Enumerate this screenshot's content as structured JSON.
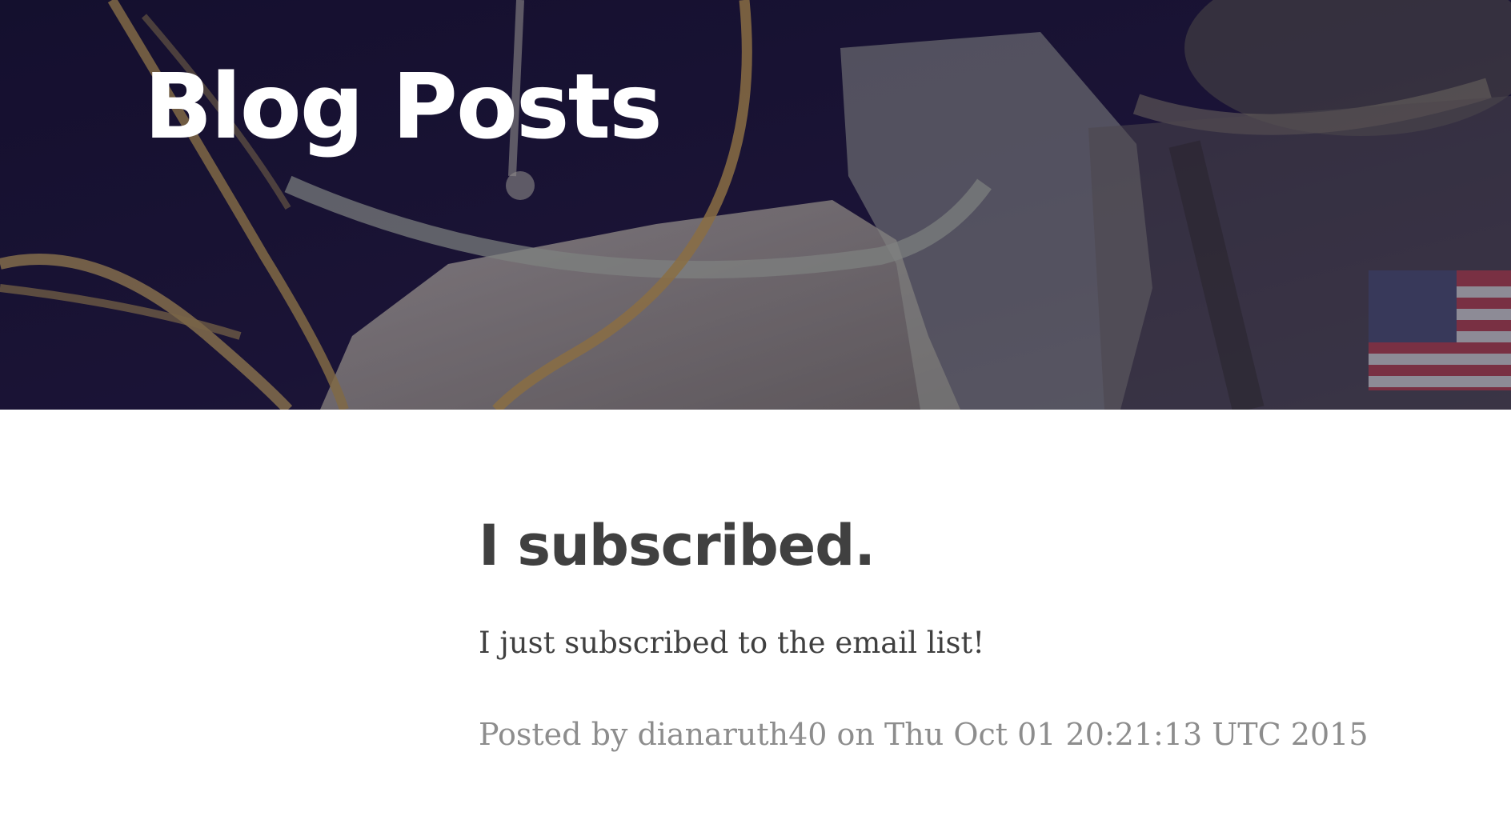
{
  "header": {
    "title": "Blog Posts",
    "background_image": "astronaut-spacewalk-image"
  },
  "post": {
    "title": "I subscribed.",
    "body": "I just subscribed to the email list!",
    "meta": "Posted by dianaruth40 on Thu Oct 01 20:21:13 UTC 2015"
  },
  "colors": {
    "heading_text": "#404040",
    "meta_text": "#8d8d8d",
    "hero_overlay": "#1b1436"
  }
}
